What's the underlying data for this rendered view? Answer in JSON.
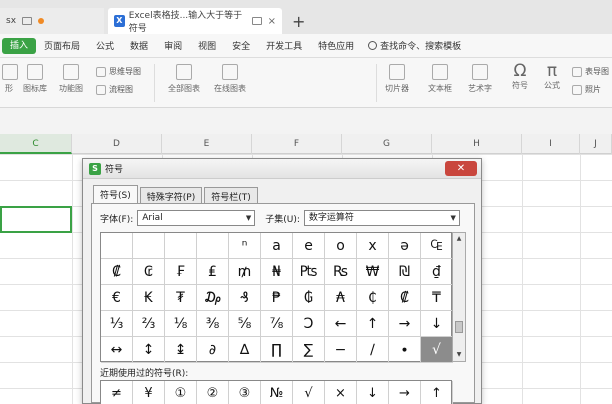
{
  "tabs": [
    {
      "label": "sx"
    },
    {
      "label": "Excel表格技...输入大于等于符号",
      "icon": "X"
    }
  ],
  "menu": [
    "插入",
    "页面布局",
    "公式",
    "数据",
    "审阅",
    "视图",
    "安全",
    "开发工具",
    "特色应用"
  ],
  "search_hint": "查找命令、搜索模板",
  "ribbon": {
    "pic_label": "形",
    "lib_label": "图标库",
    "func_label": "功能图",
    "mindmap_label": "思维导图",
    "flow_label": "流程图",
    "allchart_label": "全部图表",
    "online_label": "在线图表",
    "slicer_label": "切片器",
    "textbox_label": "文本框",
    "art_label": "艺术字",
    "symbol_label": "符号",
    "formula_label": "公式",
    "r1": "表导图",
    "r2": "照片"
  },
  "columns": [
    "C",
    "D",
    "E",
    "F",
    "G",
    "H",
    "I",
    "J"
  ],
  "dialog": {
    "title": "符号",
    "icon": "S",
    "close": "✕",
    "tabs": [
      "符号(S)",
      "特殊字符(P)",
      "符号栏(T)"
    ],
    "font_label": "字体(F):",
    "font_value": "Arial",
    "subset_label": "子集(U):",
    "subset_value": "数字运算符",
    "symbols": [
      [
        "",
        "",
        "",
        "",
        "ⁿ",
        "a",
        "e",
        "o",
        "x",
        "ə",
        "₠"
      ],
      [
        "₡",
        "₢",
        "₣",
        "₤",
        "₥",
        "₦",
        "₧",
        "₨",
        "₩",
        "₪",
        "₫"
      ],
      [
        "€",
        "₭",
        "₮",
        "₯",
        "₰",
        "₱",
        "₲",
        "₳",
        "₵",
        "₡",
        "₸"
      ],
      [
        "⅓",
        "⅔",
        "⅛",
        "⅜",
        "⅝",
        "⅞",
        "Ↄ",
        "←",
        "↑",
        "→",
        "↓"
      ],
      [
        "↔",
        "↕",
        "↨",
        "∂",
        "∆",
        "∏",
        "∑",
        "−",
        "∕",
        "∙",
        "√"
      ]
    ],
    "recent_label": "近期使用过的符号(R):",
    "recent": [
      "≠",
      "¥",
      "①",
      "②",
      "③",
      "№",
      "√",
      "×",
      "↓",
      "→",
      "↑"
    ]
  }
}
